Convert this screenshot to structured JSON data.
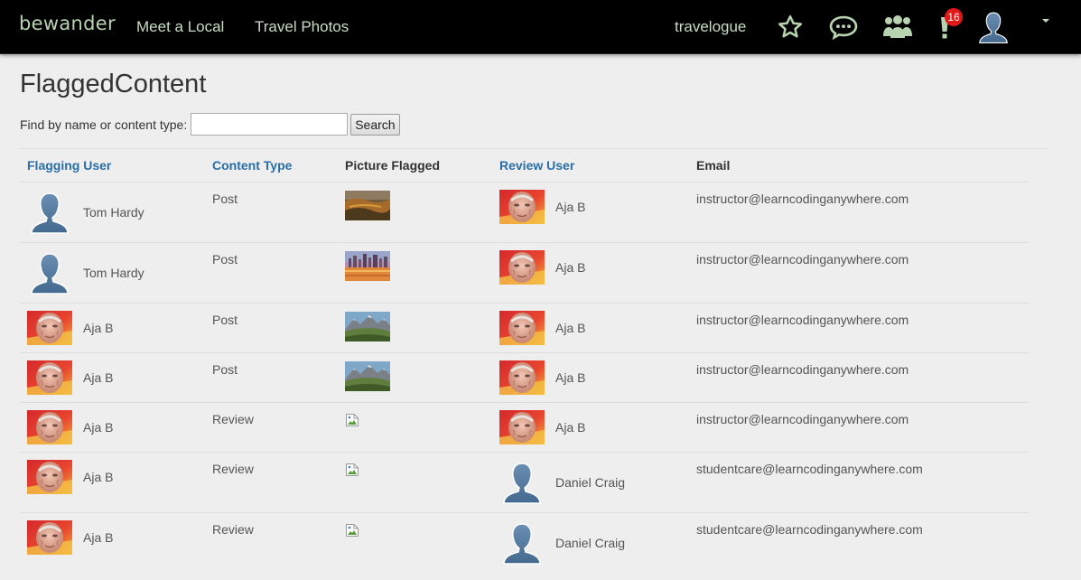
{
  "nav": {
    "brand": "bewander",
    "links": [
      "Meet a Local",
      "Travel Photos"
    ],
    "user_label": "travelogue",
    "icons": [
      "star-icon",
      "chat-bubble-icon",
      "group-icon",
      "alert-icon",
      "user-avatar-icon"
    ],
    "notification_count": "16",
    "colors": {
      "bar": "#000000",
      "text": "#c9dcc2",
      "icon": "#b7d3b0",
      "badge": "#e01818"
    }
  },
  "page": {
    "title": "FlaggedContent",
    "search": {
      "label": "Find by name or content type:",
      "value": "",
      "placeholder": "",
      "button": "Search"
    }
  },
  "table": {
    "headers": [
      "Flagging User",
      "Content Type",
      "Picture Flagged",
      "Review User",
      "Email"
    ],
    "rows": [
      {
        "flagging_user": "Tom Hardy",
        "flagging_avatar": "silhouette",
        "content_type": "Post",
        "picture": "autumn-valley",
        "review_user": "Aja B",
        "review_avatar": "photo",
        "email": "instructor@learncodinganywhere.com"
      },
      {
        "flagging_user": "Tom Hardy",
        "flagging_avatar": "silhouette",
        "content_type": "Post",
        "picture": "city-sunset",
        "review_user": "Aja B",
        "review_avatar": "photo",
        "email": "instructor@learncodinganywhere.com"
      },
      {
        "flagging_user": "Aja B",
        "flagging_avatar": "photo",
        "content_type": "Post",
        "picture": "mountain-valley",
        "review_user": "Aja B",
        "review_avatar": "photo",
        "email": "instructor@learncodinganywhere.com"
      },
      {
        "flagging_user": "Aja B",
        "flagging_avatar": "photo",
        "content_type": "Post",
        "picture": "mountain-valley",
        "review_user": "Aja B",
        "review_avatar": "photo",
        "email": "instructor@learncodinganywhere.com"
      },
      {
        "flagging_user": "Aja B",
        "flagging_avatar": "photo",
        "content_type": "Review",
        "picture": "broken",
        "review_user": "Aja B",
        "review_avatar": "photo",
        "email": "instructor@learncodinganywhere.com"
      },
      {
        "flagging_user": "Aja B",
        "flagging_avatar": "photo",
        "content_type": "Review",
        "picture": "broken",
        "review_user": "Daniel Craig",
        "review_avatar": "silhouette",
        "email": "studentcare@learncodinganywhere.com"
      },
      {
        "flagging_user": "Aja B",
        "flagging_avatar": "photo",
        "content_type": "Review",
        "picture": "broken",
        "review_user": "Daniel Craig",
        "review_avatar": "silhouette",
        "email": "studentcare@learncodinganywhere.com"
      }
    ]
  }
}
